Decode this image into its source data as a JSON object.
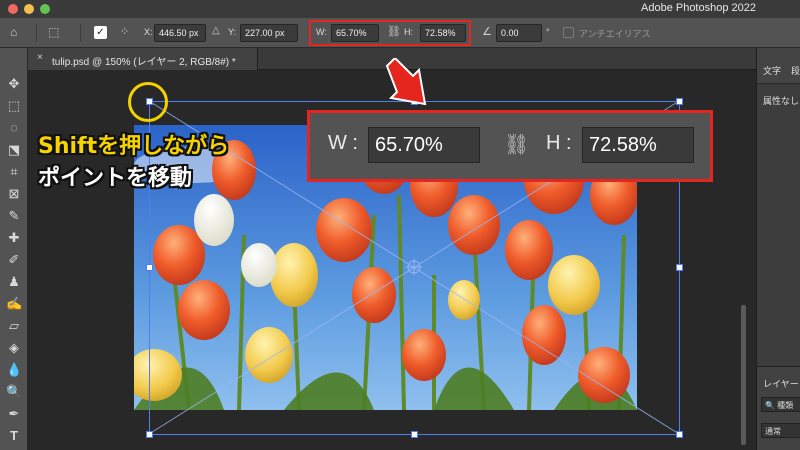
{
  "app": {
    "title": "Adobe Photoshop 2022"
  },
  "options_bar": {
    "x_label": "X:",
    "x_value": "446.50 px",
    "y_label": "Y:",
    "y_value": "227.00 px",
    "w_label": "W:",
    "w_value": "65.70%",
    "h_label": "H:",
    "h_value": "72.58%",
    "angle_value": "0.00",
    "angle_unit": "°",
    "antialias_label": "アンチエイリアス"
  },
  "document_tab": {
    "close": "×",
    "label": "tulip.psd @ 150% (レイヤー 2, RGB/8#) *"
  },
  "right_panel": {
    "tab_character": "文字",
    "tab_paragraph": "段",
    "attribute_label": "属性なし",
    "layers_label": "レイヤー",
    "search_placeholder": "🔍 種類",
    "blend_mode": "通常"
  },
  "annotation": {
    "line1": "Shiftを押しながら",
    "line2": "ポイントを移動",
    "zoom_w_label": "W :",
    "zoom_w_value": "65.70%",
    "zoom_h_label": "H :",
    "zoom_h_value": "72.58%"
  },
  "colors": {
    "highlight_red": "#e5261f",
    "circle_yellow": "#f2d200",
    "transform_blue": "#4d7ff0"
  },
  "icons": {
    "home": "home-icon",
    "link": "link-icon",
    "angle": "angle-icon",
    "arrow": "red-arrow-icon"
  }
}
